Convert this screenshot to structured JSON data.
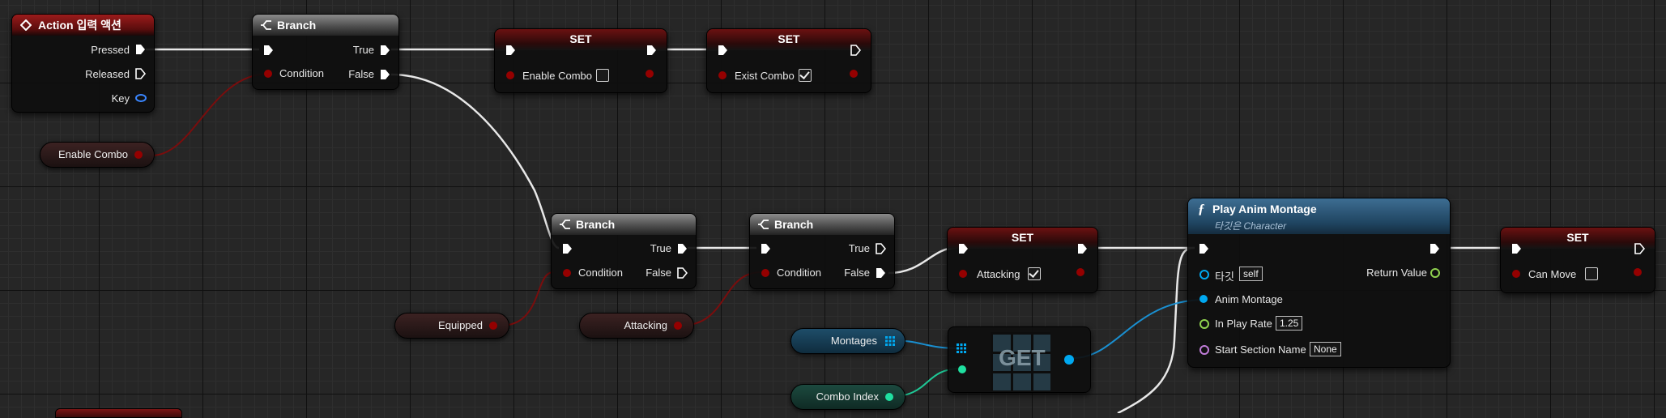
{
  "colors": {
    "exec": "#ffffff",
    "bool": "#950000",
    "object": "#00a8f0",
    "float": "#8fd14f",
    "integer": "#1fe0a0",
    "name": "#c07cd8",
    "key": "#3a86ff"
  },
  "event_node": {
    "title": "Action 입력 액션",
    "pins": {
      "pressed": "Pressed",
      "released": "Released",
      "key": "Key"
    }
  },
  "branch1": {
    "title": "Branch",
    "condition": "Condition",
    "true": "True",
    "false": "False"
  },
  "branch2": {
    "title": "Branch",
    "condition": "Condition",
    "true": "True",
    "false": "False"
  },
  "branch3": {
    "title": "Branch",
    "condition": "Condition",
    "true": "True",
    "false": "False"
  },
  "set_enable_combo": {
    "title": "SET",
    "var": "Enable Combo",
    "checked": false
  },
  "set_exist_combo": {
    "title": "SET",
    "var": "Exist Combo",
    "checked": true
  },
  "set_attacking": {
    "title": "SET",
    "var": "Attacking",
    "checked": true
  },
  "set_can_move": {
    "title": "SET",
    "var": "Can Move",
    "checked": false
  },
  "play_anim": {
    "title": "Play Anim Montage",
    "subtitle": "타깃은 Character",
    "target_label": "타깃",
    "target_value": "self",
    "anim_montage": "Anim Montage",
    "play_rate_label": "In Play Rate",
    "play_rate_value": "1.25",
    "start_section_label": "Start Section Name",
    "start_section_value": "None",
    "return_value": "Return Value"
  },
  "get_node": {
    "title": "GET"
  },
  "variables": {
    "enable_combo": "Enable Combo",
    "equipped": "Equipped",
    "attacking": "Attacking",
    "montages": "Montages",
    "combo_index": "Combo Index"
  }
}
